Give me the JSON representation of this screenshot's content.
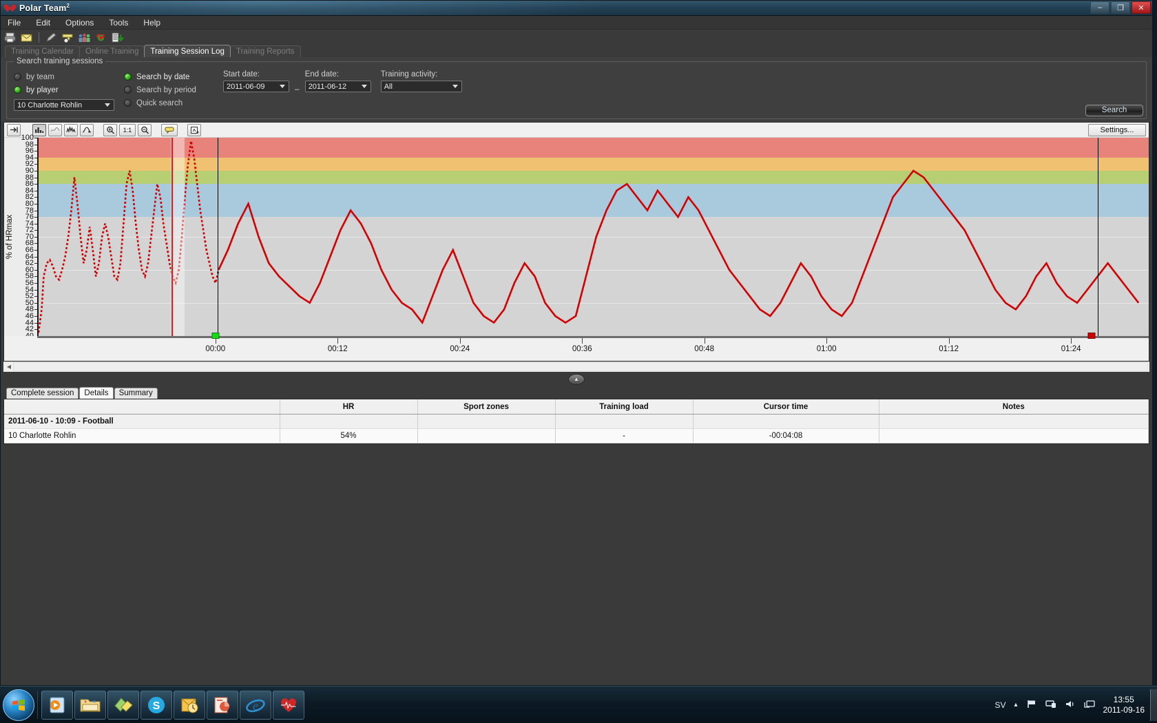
{
  "window": {
    "title": "Polar Team",
    "title_sup": "2",
    "minimize": "–",
    "maximize": "❐",
    "close": "✕"
  },
  "menu": [
    "File",
    "Edit",
    "Options",
    "Tools",
    "Help"
  ],
  "app_toolbar": [
    {
      "name": "print-icon",
      "glyph": "🖨"
    },
    {
      "name": "mail-icon",
      "glyph": "✉"
    },
    {
      "name": "separator",
      "glyph": ""
    },
    {
      "name": "edit-pencil-icon",
      "glyph": "✎"
    },
    {
      "name": "add-team-icon",
      "glyph": "▬"
    },
    {
      "name": "team-group-icon",
      "glyph": "👥"
    },
    {
      "name": "heart-sync-icon",
      "glyph": "♥"
    },
    {
      "name": "export-data-icon",
      "glyph": "↓"
    }
  ],
  "tabs": [
    {
      "label": "Training Calendar",
      "active": false
    },
    {
      "label": "Online Training",
      "active": false
    },
    {
      "label": "Training Session Log",
      "active": true
    },
    {
      "label": "Training Reports",
      "active": false
    }
  ],
  "search": {
    "legend": "Search training sessions",
    "scope_options": [
      {
        "label": "by team",
        "selected": false
      },
      {
        "label": "by player",
        "selected": true
      }
    ],
    "player_select": "10 Charlotte Rohlin",
    "mode_options": [
      {
        "label": "Search by date",
        "selected": true
      },
      {
        "label": "Search by period",
        "selected": false
      },
      {
        "label": "Quick search",
        "selected": false
      }
    ],
    "start_date_label": "Start date:",
    "start_date_value": "2011-06-09",
    "range_separator": "–",
    "end_date_label": "End date:",
    "end_date_value": "2011-06-12",
    "activity_label": "Training activity:",
    "activity_value": "All",
    "search_button": "Search"
  },
  "chart_toolbar": {
    "collapse_icon": "→|",
    "buttons": [
      {
        "name": "bar-curve-view-button",
        "glyph": "▁▃▅",
        "pressed": true
      },
      {
        "name": "smooth-curve-view-button",
        "glyph": "〜",
        "pressed": false
      },
      {
        "name": "raw-curve-view-button",
        "glyph": "⌇",
        "pressed": false
      },
      {
        "name": "markers-view-button",
        "glyph": "✦",
        "pressed": false
      },
      {
        "name": "zoom-in-button",
        "glyph": "⌕",
        "pressed": false
      },
      {
        "name": "zoom-reset-button",
        "glyph": "1·1",
        "pressed": false
      },
      {
        "name": "zoom-out-button",
        "glyph": "⌕",
        "pressed": false
      },
      {
        "name": "tooltip-toggle-button",
        "glyph": "▭",
        "pressed": false
      },
      {
        "name": "export-chart-button",
        "glyph": "⎘",
        "pressed": false
      }
    ],
    "settings_button": "Settings..."
  },
  "chart_data": {
    "type": "line",
    "title": "",
    "xlabel": "",
    "ylabel": "% of HRmax",
    "ylim": [
      40,
      100
    ],
    "ytick_step": 2,
    "yticks": [
      100,
      98,
      96,
      94,
      92,
      90,
      88,
      86,
      84,
      82,
      80,
      78,
      76,
      74,
      72,
      70,
      68,
      66,
      64,
      62,
      60,
      58,
      56,
      54,
      52,
      50,
      48,
      46,
      44,
      42,
      40
    ],
    "xticks": [
      "00:00",
      "00:12",
      "00:24",
      "00:36",
      "00:48",
      "01:00",
      "01:12",
      "01:24"
    ],
    "xtick_minutes": [
      0,
      12,
      24,
      36,
      48,
      60,
      72,
      84
    ],
    "xlim_minutes": [
      -17.5,
      91.0
    ],
    "grid": true,
    "legend": "none",
    "series_name": "Heart rate (% of HRmax)",
    "series_color": "#d40000",
    "zones": [
      {
        "name": "zone5-maximum",
        "from": 94,
        "to": 100,
        "color": "#e8837b"
      },
      {
        "name": "zone4-hard",
        "from": 90,
        "to": 94,
        "color": "#f0c170"
      },
      {
        "name": "zone3-moderate",
        "from": 86,
        "to": 90,
        "color": "#b8ce72"
      },
      {
        "name": "zone2-light",
        "from": 76,
        "to": 86,
        "color": "#a9c9dd"
      },
      {
        "name": "zone1-very-light",
        "from": 40,
        "to": 76,
        "color": "#d4d4d4"
      }
    ],
    "markers": [
      {
        "name": "session-start-marker",
        "time": "00:00",
        "color": "#13dd13"
      },
      {
        "name": "session-end-marker",
        "time": "01:26",
        "color": "#cc0000"
      }
    ],
    "cursor_lines": [
      {
        "name": "cursor-black-start",
        "time": "00:00",
        "color": "#000000"
      },
      {
        "name": "cursor-black-end",
        "time": "01:26",
        "color": "#000000"
      },
      {
        "name": "cursor-red-selection",
        "time": "-00:04:08",
        "color": "#d42020"
      }
    ],
    "x": [
      -17.5,
      -17.2,
      -17.0,
      -16.7,
      -16.4,
      -16.1,
      -15.8,
      -15.5,
      -15.2,
      -14.9,
      -14.6,
      -14.3,
      -14.0,
      -13.7,
      -13.4,
      -13.1,
      -12.8,
      -12.5,
      -12.2,
      -11.9,
      -11.6,
      -11.3,
      -11.0,
      -10.7,
      -10.4,
      -10.1,
      -9.8,
      -9.5,
      -9.2,
      -8.9,
      -8.6,
      -8.3,
      -8.0,
      -7.7,
      -7.4,
      -7.1,
      -6.8,
      -6.5,
      -6.2,
      -5.9,
      -5.6,
      -5.3,
      -5.0,
      -4.7,
      -4.4,
      -4.1,
      -3.8,
      -3.5,
      -3.2,
      -2.9,
      -2.6,
      -2.3,
      -2.0,
      -1.7,
      -1.4,
      -1.1,
      -0.8,
      -0.5,
      -0.2,
      0.1,
      1.0,
      2.0,
      3.0,
      4.0,
      5.0,
      6.0,
      7.0,
      8.0,
      9.0,
      10.0,
      11.0,
      12.0,
      13.0,
      14.0,
      15.0,
      16.0,
      17.0,
      18.0,
      19.0,
      20.0,
      21.0,
      22.0,
      23.0,
      24.0,
      25.0,
      26.0,
      27.0,
      28.0,
      29.0,
      30.0,
      31.0,
      32.0,
      33.0,
      34.0,
      35.0,
      36.0,
      37.0,
      38.0,
      39.0,
      40.0,
      41.0,
      42.0,
      43.0,
      44.0,
      45.0,
      46.0,
      47.0,
      48.0,
      49.0,
      50.0,
      51.0,
      52.0,
      53.0,
      54.0,
      55.0,
      56.0,
      57.0,
      58.0,
      59.0,
      60.0,
      61.0,
      62.0,
      63.0,
      64.0,
      65.0,
      66.0,
      67.0,
      68.0,
      69.0,
      70.0,
      71.0,
      72.0,
      73.0,
      74.0,
      75.0,
      76.0,
      77.0,
      78.0,
      79.0,
      80.0,
      81.0,
      82.0,
      83.0,
      84.0,
      85.0,
      86.0,
      87.0,
      88.0,
      89.0,
      90.0
    ],
    "y": [
      41,
      48,
      58,
      62,
      63,
      61,
      58,
      57,
      60,
      64,
      70,
      78,
      88,
      80,
      70,
      62,
      66,
      73,
      66,
      58,
      62,
      70,
      74,
      70,
      64,
      58,
      57,
      62,
      74,
      86,
      90,
      84,
      74,
      66,
      60,
      58,
      62,
      70,
      78,
      86,
      82,
      74,
      68,
      62,
      58,
      56,
      60,
      70,
      82,
      92,
      99,
      94,
      86,
      78,
      72,
      66,
      62,
      58,
      56,
      60,
      66,
      74,
      80,
      70,
      62,
      58,
      55,
      52,
      50,
      56,
      64,
      72,
      78,
      74,
      68,
      60,
      54,
      50,
      48,
      44,
      52,
      60,
      66,
      58,
      50,
      46,
      44,
      48,
      56,
      62,
      58,
      50,
      46,
      44,
      46,
      58,
      70,
      78,
      84,
      86,
      82,
      78,
      84,
      80,
      76,
      82,
      78,
      72,
      66,
      60,
      56,
      52,
      48,
      46,
      50,
      56,
      62,
      58,
      52,
      48,
      46,
      50,
      58,
      66,
      74,
      82,
      86,
      90,
      88,
      84,
      80,
      76,
      72,
      66,
      60,
      54,
      50,
      48,
      52,
      58,
      62,
      56,
      52,
      50,
      54,
      58,
      62,
      58,
      54,
      50,
      48,
      46,
      44,
      46,
      50,
      54,
      58,
      52,
      48,
      46,
      50
    ]
  },
  "bottom_tabs": [
    {
      "label": "Complete session",
      "active": false
    },
    {
      "label": "Details",
      "active": true
    },
    {
      "label": "Summary",
      "active": false
    }
  ],
  "table": {
    "columns": [
      "",
      "HR",
      "Sport zones",
      "Training load",
      "Cursor time",
      "Notes"
    ],
    "rows": [
      {
        "type": "session",
        "cells": [
          "2011-06-10 - 10:09 - Football",
          "",
          "",
          "",
          "",
          ""
        ]
      },
      {
        "type": "player",
        "cells": [
          "10 Charlotte Rohlin",
          "54%",
          "",
          "-",
          "-00:04:08",
          ""
        ]
      }
    ]
  },
  "taskbar": {
    "start_label": "Start",
    "items": [
      {
        "name": "taskbar-media-player",
        "glyph": "▶"
      },
      {
        "name": "taskbar-explorer",
        "glyph": "🗀"
      },
      {
        "name": "taskbar-sticky-notes",
        "glyph": "◧"
      },
      {
        "name": "taskbar-skype",
        "glyph": "S"
      },
      {
        "name": "taskbar-outlook",
        "glyph": "✉"
      },
      {
        "name": "taskbar-powerpoint",
        "glyph": "P"
      },
      {
        "name": "taskbar-internet-explorer",
        "glyph": "e"
      },
      {
        "name": "taskbar-polar-team",
        "glyph": "♥"
      }
    ],
    "tray": {
      "language": "SV",
      "show_hidden": "▴",
      "flag_icon": "⚑",
      "action_center_icon": "⚑",
      "volume_icon": "🔊",
      "network_icon": "🖥",
      "time": "13:55",
      "date": "2011-09-16"
    }
  }
}
